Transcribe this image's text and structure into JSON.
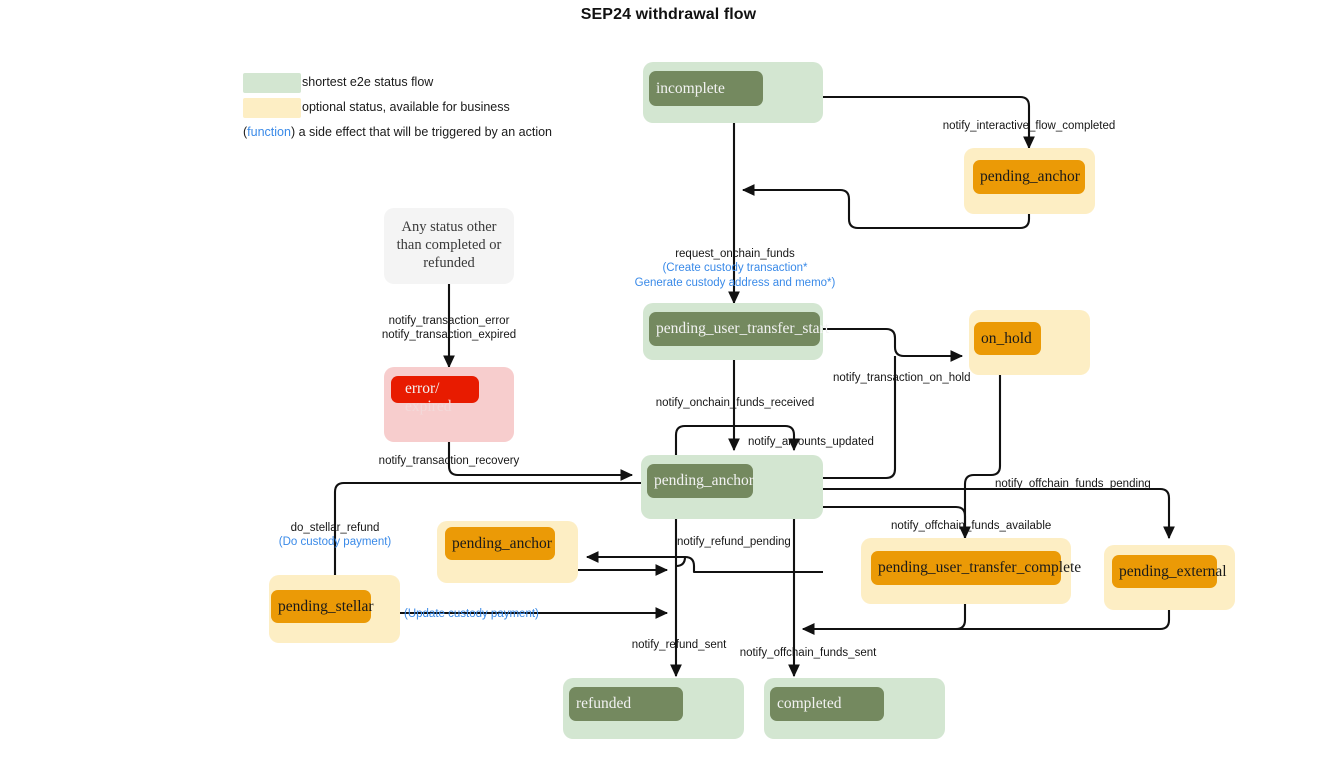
{
  "title": "SEP24 withdrawal flow",
  "colors": {
    "shortest_outer": "#d3e6d1",
    "shortest_inner": "#74895f",
    "optional_outer": "#fdeec4",
    "optional_inner": "#eb9a06",
    "error_outer": "#f7cdcd",
    "error_inner": "#e81b00",
    "plain_outer": "#f4f4f4",
    "function_text": "#3a8ae8",
    "edge": "#111111"
  },
  "legend": {
    "items": [
      {
        "swatch": "shortest_outer",
        "label": "shortest e2e status flow"
      },
      {
        "swatch": "optional_outer",
        "label": "optional status, available for business"
      }
    ],
    "function_note": {
      "prefix": "(",
      "keyword": "function",
      "suffix": ")",
      "text": "a side effect that will be triggered by an action"
    }
  },
  "nodes": {
    "incomplete": {
      "label": "incomplete",
      "kind": "shortest"
    },
    "pending_anchor_top": {
      "label": "pending_anchor",
      "kind": "optional"
    },
    "any_status": {
      "line1": "Any status other",
      "line2": "than completed or",
      "line3": "refunded",
      "kind": "plain"
    },
    "error_expired": {
      "label1": "error/",
      "label2": "expired",
      "kind": "error"
    },
    "pending_user_transfer_start": {
      "label": "pending_user_transfer_start",
      "kind": "shortest"
    },
    "on_hold": {
      "label": "on_hold",
      "kind": "optional"
    },
    "pending_anchor_center": {
      "label": "pending_anchor",
      "kind": "shortest"
    },
    "pending_anchor_refund": {
      "label": "pending_anchor",
      "kind": "optional"
    },
    "pending_stellar": {
      "label": "pending_stellar",
      "kind": "optional"
    },
    "pending_user_transfer_complete": {
      "label": "pending_user_transfer_complete",
      "kind": "optional"
    },
    "pending_external": {
      "label": "pending_external",
      "kind": "optional"
    },
    "refunded": {
      "label": "refunded",
      "kind": "shortest"
    },
    "completed": {
      "label": "completed",
      "kind": "shortest"
    }
  },
  "edge_labels": {
    "notify_interactive_flow_completed": "notify_interactive_flow_completed",
    "request_onchain_funds": "request_onchain_funds",
    "request_onchain_funds_fn1": "(Create custody transaction*",
    "request_onchain_funds_fn2": "Generate custody address and memo*)",
    "notify_transaction_error": "notify_transaction_error",
    "notify_transaction_expired": "notify_transaction_expired",
    "notify_transaction_recovery": "notify_transaction_recovery",
    "notify_onchain_funds_received": "notify_onchain_funds_received",
    "notify_amounts_updated": "notify_amounts_updated",
    "notify_transaction_on_hold": "notify_transaction_on_hold",
    "notify_offchain_funds_pending": "notify_offchain_funds_pending",
    "notify_offchain_funds_available": "notify_offchain_funds_available",
    "do_stellar_refund": "do_stellar_refund",
    "do_stellar_refund_fn": "(Do custody payment)",
    "update_custody_payment_fn": "(Update custody payment)",
    "notify_refund_pending": "notify_refund_pending",
    "notify_refund_sent": "notify_refund_sent",
    "notify_offchain_funds_sent": "notify_offchain_funds_sent"
  }
}
